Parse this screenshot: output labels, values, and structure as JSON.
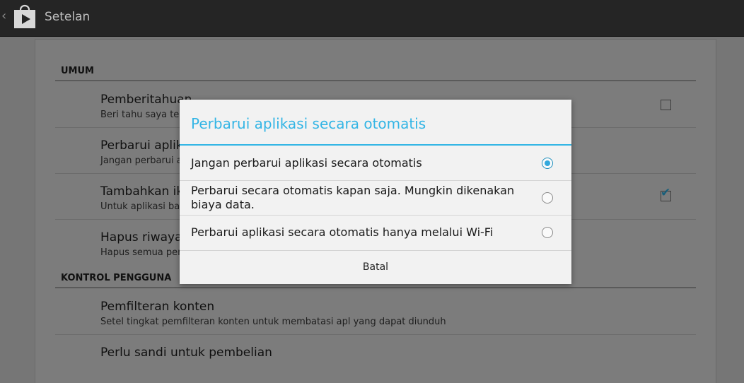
{
  "action_bar": {
    "title": "Setelan",
    "up_icon": "chevron-left-icon",
    "app_icon": "play-store-bag-icon"
  },
  "settings": {
    "section_general": "UMUM",
    "section_user_controls": "KONTROL PENGGUNA",
    "items": [
      {
        "title": "Pemberitahuan",
        "summary": "Beri tahu saya ten",
        "checkbox": "unchecked"
      },
      {
        "title": "Perbarui aplik",
        "summary": "Jangan perbarui a"
      },
      {
        "title": "Tambahkan ik",
        "summary": "Untuk aplikasi bar",
        "checkbox": "checked"
      },
      {
        "title": "Hapus riwayat",
        "summary": "Hapus semua pen"
      },
      {
        "title": "Pemfilteran konten",
        "summary": "Setel tingkat pemfilteran konten untuk membatasi apl yang dapat diunduh"
      },
      {
        "title": "Perlu sandi untuk pembelian"
      }
    ]
  },
  "dialog": {
    "title": "Perbarui aplikasi secara otomatis",
    "options": [
      {
        "label": "Jangan perbarui aplikasi secara otomatis",
        "selected": true
      },
      {
        "label": "Perbarui secara otomatis kapan saja. Mungkin dikenakan biaya data.",
        "selected": false
      },
      {
        "label": "Perbarui aplikasi secara otomatis hanya melalui Wi-Fi",
        "selected": false
      }
    ],
    "cancel_label": "Batal"
  },
  "colors": {
    "accent": "#33b5e5",
    "action_bar": "#252525",
    "dim_background": "#767676"
  }
}
